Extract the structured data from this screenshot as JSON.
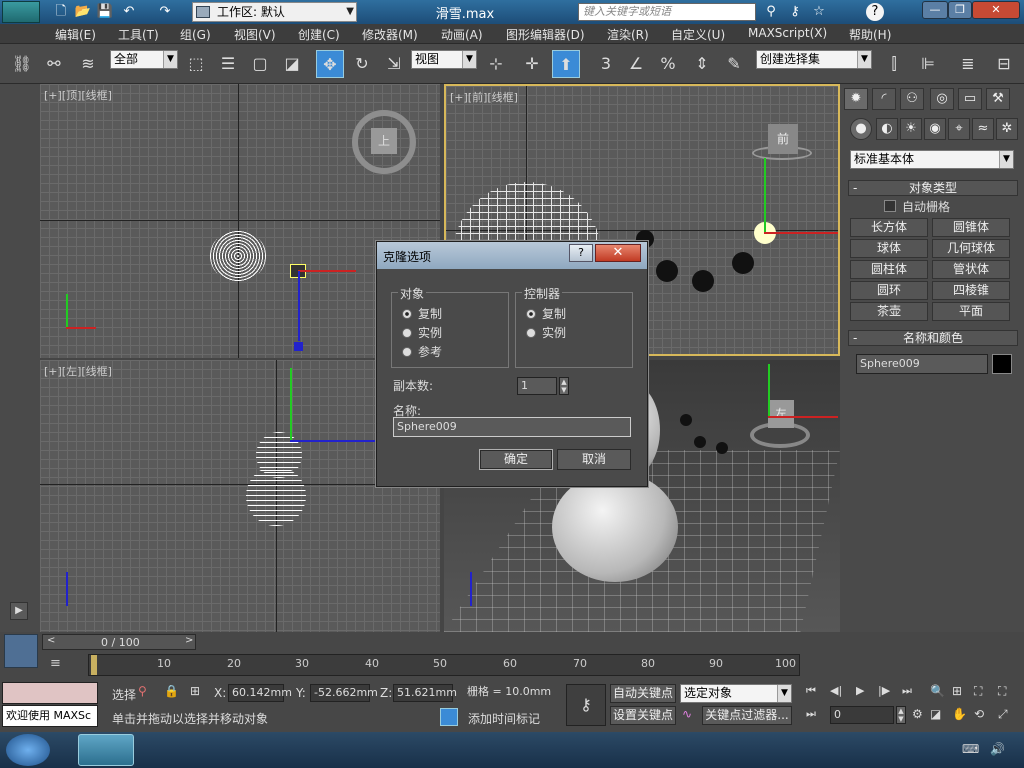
{
  "titlebar": {
    "workspace_label": "工作区: 默认",
    "file_title": "滑雪.max",
    "search_placeholder": "键入关键字或短语"
  },
  "menubar": {
    "items": [
      "编辑(E)",
      "工具(T)",
      "组(G)",
      "视图(V)",
      "创建(C)",
      "修改器(M)",
      "动画(A)",
      "图形编辑器(D)",
      "渲染(R)",
      "自定义(U)",
      "MAXScript(X)",
      "帮助(H)"
    ]
  },
  "toolbar": {
    "filter_value": "全部",
    "coord_value": "视图",
    "selection_set_value": "创建选择集",
    "snap_3": "3",
    "snap_percent": "%"
  },
  "viewports": {
    "top_label": "[+][顶][线框]",
    "front_label": "[+][前][线框]",
    "left_label": "[+][左][线框]",
    "top_cube": "上",
    "front_cube": "前",
    "persp_cube": "左"
  },
  "dialog": {
    "title": "克隆选项",
    "help": "?",
    "close": "✕",
    "object_group": "对象",
    "object_options": [
      "复制",
      "实例",
      "参考"
    ],
    "object_selected": 0,
    "controller_group": "控制器",
    "controller_options": [
      "复制",
      "实例"
    ],
    "controller_selected": 0,
    "copies_label": "副本数:",
    "copies_value": "1",
    "name_label": "名称:",
    "name_value": "Sphere009",
    "ok": "确定",
    "cancel": "取消"
  },
  "command_panel": {
    "category": "标准基本体",
    "object_type_title": "对象类型",
    "autogrid": "自动栅格",
    "buttons": [
      "长方体",
      "圆锥体",
      "球体",
      "几何球体",
      "圆柱体",
      "管状体",
      "圆环",
      "四棱锥",
      "茶壶",
      "平面"
    ],
    "name_color_title": "名称和颜色",
    "name_value": "Sphere009",
    "object_color": "#000000"
  },
  "timeline": {
    "frame_counter": "0 / 100",
    "ticks": [
      "10",
      "20",
      "30",
      "40",
      "50",
      "60",
      "70",
      "80",
      "90",
      "100"
    ]
  },
  "status": {
    "welcome": "欢迎使用 MAXSc",
    "select_label": "选择",
    "x_label": "X:",
    "x_value": "60.142mm",
    "y_label": "Y:",
    "y_value": "-52.662mm",
    "z_label": "Z:",
    "z_value": "51.621mm",
    "grid_value": "栅格 = 10.0mm",
    "prompt": "单击并拖动以选择并移动对象",
    "add_time_tag": "添加时间标记",
    "auto_key": "自动关键点",
    "set_key": "设置关键点",
    "key_mode": "选定对象",
    "key_filters": "关键点过滤器...",
    "frame_value": "0"
  },
  "colors": {
    "accent": "#3b8bd6",
    "active_viewport": "#d7b85a",
    "dialog_close": "#c13b24"
  }
}
